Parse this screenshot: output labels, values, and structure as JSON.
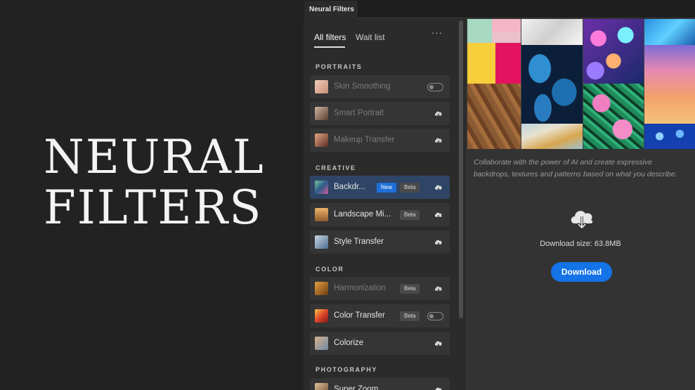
{
  "hero": {
    "line1": "NEURAL",
    "line2": "FILTERS"
  },
  "window": {
    "tab_title": "Neural Filters"
  },
  "subtabs": {
    "all": "All filters",
    "waitlist": "Wait list",
    "more": "···"
  },
  "sections": {
    "portraits": "PORTRAITS",
    "creative": "CREATIVE",
    "color": "COLOR",
    "photography": "PHOTOGRAPHY"
  },
  "filters": [
    {
      "label": "Skin Smoothing",
      "control": "toggle-off",
      "state": "disabled",
      "thumb_color": "#e3b8a3"
    },
    {
      "label": "Smart Portrait",
      "control": "cloud-download-icon",
      "state": "disabled",
      "thumb_color": "#8a6b58"
    },
    {
      "label": "Makeup Transfer",
      "control": "cloud-download-icon",
      "state": "disabled",
      "thumb_color": "#b26b4e"
    },
    {
      "label": "Backdr...",
      "badges": [
        "New",
        "Beta"
      ],
      "control": "cloud-download-icon",
      "state": "selected",
      "thumb_color": "#3f8a6a"
    },
    {
      "label": "Landscape Mi...",
      "badges": [
        "Beta"
      ],
      "control": "cloud-download-icon",
      "state": "enabled",
      "thumb_color": "#c98a4a"
    },
    {
      "label": "Style Transfer",
      "control": "cloud-download-icon",
      "state": "enabled",
      "thumb_color": "#6a8fb0"
    },
    {
      "label": "Harmonization",
      "badges": [
        "Beta"
      ],
      "control": "cloud-download-icon",
      "state": "disabled",
      "thumb_color": "#c6882e"
    },
    {
      "label": "Color Transfer",
      "badges": [
        "Beta"
      ],
      "control": "toggle-off",
      "state": "enabled",
      "thumb_color": "#e05a2c"
    },
    {
      "label": "Colorize",
      "control": "cloud-download-icon",
      "state": "enabled",
      "thumb_color": "#9aa4b3"
    },
    {
      "label": "Super Zoom",
      "control": "cloud-download-icon",
      "state": "enabled",
      "thumb_color": "#b48a5f"
    }
  ],
  "detail": {
    "description": "Collaborate with the power of AI and create expressive backdrops, textures and patterns based on what you describe.",
    "download_size": "Download size: 63.8MB",
    "download_label": "Download"
  },
  "colors": {
    "accent": "#1473e6",
    "selected_row": "#2f4565",
    "new_badge": "#1f6fd8"
  }
}
